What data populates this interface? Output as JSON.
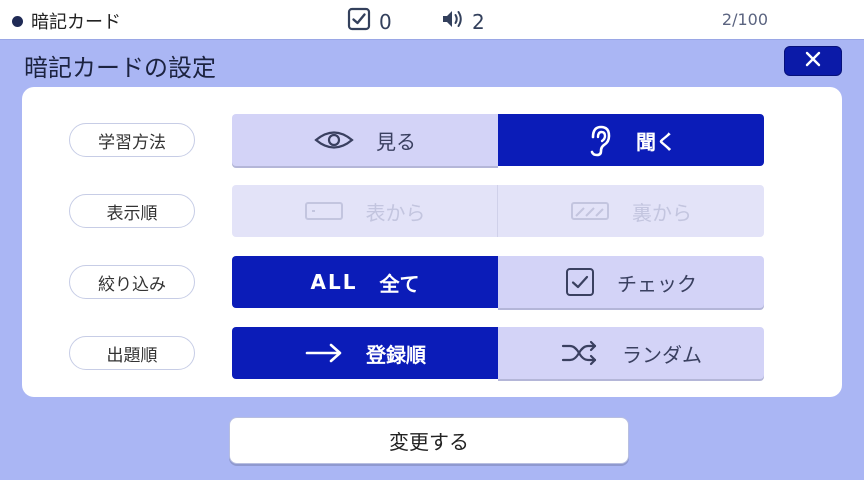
{
  "topbar": {
    "title": "暗記カード",
    "check_count": "0",
    "audio_count": "2",
    "page": "2/100"
  },
  "heading": "暗記カードの設定",
  "rows": [
    {
      "label": "学習方法",
      "options": [
        {
          "label": "見る",
          "icon": "eye-icon",
          "state": "off"
        },
        {
          "label": "聞く",
          "icon": "ear-icon",
          "state": "on"
        }
      ]
    },
    {
      "label": "表示順",
      "options": [
        {
          "label": "表から",
          "icon": "card-front-icon",
          "state": "disabled"
        },
        {
          "label": "裏から",
          "icon": "card-back-icon",
          "state": "disabled"
        }
      ]
    },
    {
      "label": "絞り込み",
      "options": [
        {
          "label": "全て",
          "prefix": "ALL",
          "state": "on"
        },
        {
          "label": "チェック",
          "icon": "checkbox-icon",
          "state": "off"
        }
      ]
    },
    {
      "label": "出題順",
      "options": [
        {
          "label": "登録順",
          "icon": "arrow-right-icon",
          "state": "on"
        },
        {
          "label": "ランダム",
          "icon": "shuffle-icon",
          "state": "off"
        }
      ]
    }
  ],
  "footer": {
    "change_label": "変更する"
  },
  "colors": {
    "accent": "#0b1cb8",
    "background": "#aab6f4",
    "option_off": "#d3d3f7",
    "option_disabled": "#e3e3f8"
  }
}
